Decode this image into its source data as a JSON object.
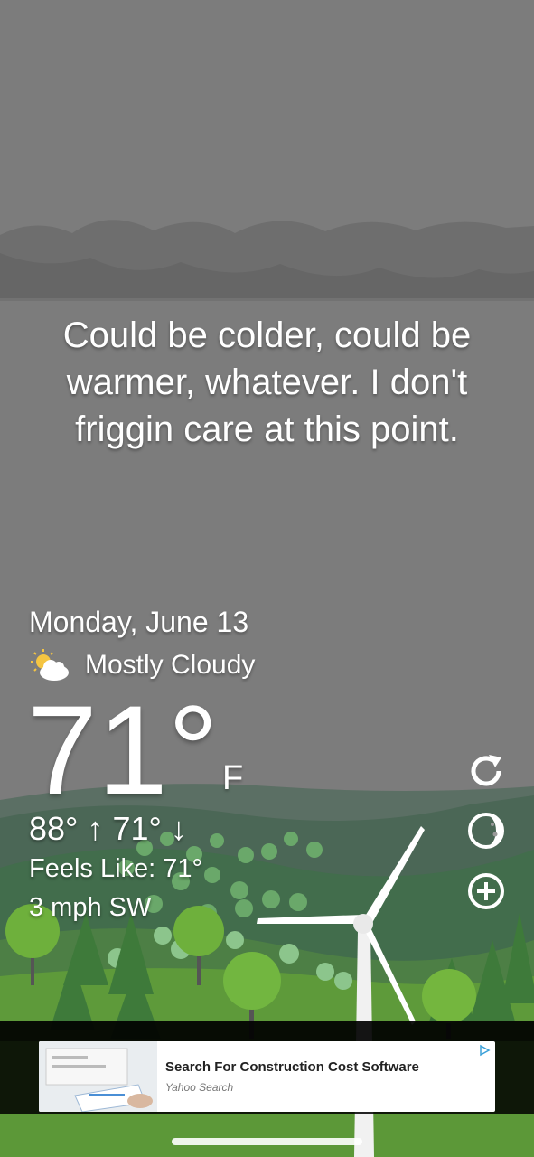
{
  "quote": "Could be colder, could be warmer, whatever. I don't friggin care at this point.",
  "date": "Monday, June 13",
  "condition": {
    "text": "Mostly Cloudy",
    "icon": "partly-cloudy-icon"
  },
  "temperature": {
    "value": "71°",
    "unit": "F"
  },
  "high_low": "88° ↑ 71° ↓",
  "feels_like": "Feels Like: 71°",
  "wind": "3 mph SW",
  "side_buttons": [
    {
      "icon": "refresh-icon"
    },
    {
      "icon": "moon-phase-icon"
    },
    {
      "icon": "add-location-icon"
    }
  ],
  "ad": {
    "title": "Search For Construction Cost Software",
    "source": "Yahoo Search",
    "choice_icon": "ad-choices-icon"
  },
  "colors": {
    "sky": "#7b7b7b",
    "cloud_band": "#6d6d6d",
    "hills_far": "#4f6a5d",
    "hills_mid": "#3f6b4a",
    "grass": "#5e9a3a",
    "text": "#ffffff"
  }
}
